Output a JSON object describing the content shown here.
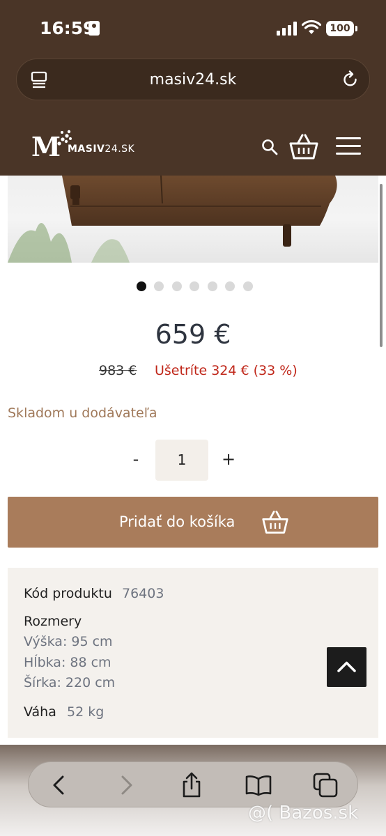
{
  "status_bar": {
    "time": "16:59",
    "battery": "100"
  },
  "browser": {
    "url": "masiv24.sk"
  },
  "site_header": {
    "logo_letter": "M",
    "brand_name": "MASIV",
    "brand_suffix": "24.SK"
  },
  "gallery": {
    "dot_count": 7,
    "active_index": 0
  },
  "product": {
    "price": "659 €",
    "old_price": "983 €",
    "savings": "Ušetríte 324 € (33 %)",
    "availability": "Skladom u dodávateľa",
    "quantity": {
      "minus": "-",
      "value": "1",
      "plus": "+"
    },
    "add_to_cart": "Pridať do košíka"
  },
  "details": {
    "code_label": "Kód produktu",
    "code_value": "76403",
    "dimensions_label": "Rozmery",
    "height": "Výška: 95 cm",
    "depth": "Hĺbka: 88 cm",
    "width": "Šírka: 220 cm",
    "weight_label": "Váha",
    "weight_value": "52 kg"
  },
  "watermark": "@( Bazos.sk",
  "colors": {
    "header": "#4a3527",
    "accent": "#a97c5b",
    "savings": "#c0271a",
    "stock": "#a0795a"
  },
  "icons": [
    "tabs-icon",
    "reload-icon",
    "search-icon",
    "cart-icon",
    "menu-icon",
    "basket-icon",
    "chevron-up-icon",
    "back-icon",
    "forward-icon",
    "share-icon",
    "bookmarks-icon",
    "tabs-overview-icon"
  ]
}
